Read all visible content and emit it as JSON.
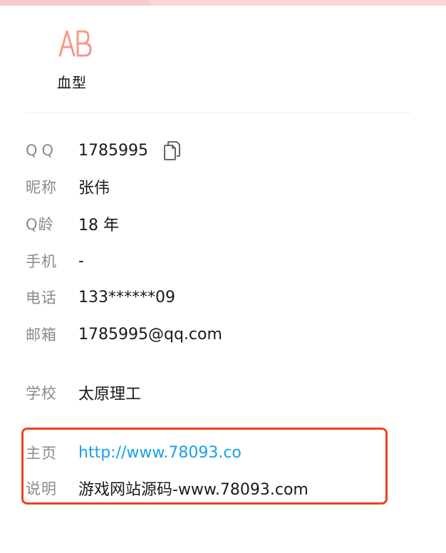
{
  "blood_type": {
    "icon": "ab-blood-type-icon",
    "label": "血型"
  },
  "profile": {
    "rows": [
      {
        "label": "QQ",
        "value": "1785995"
      },
      {
        "label": "昵称",
        "value": "张伟"
      },
      {
        "label": "Q龄",
        "value": "18 年"
      },
      {
        "label": "手机",
        "value": "-"
      },
      {
        "label": "电话",
        "value": "133******09"
      },
      {
        "label": "邮箱",
        "value": "1785995@qq.com"
      }
    ],
    "school": {
      "label": "学校",
      "value": "太原理工"
    },
    "homepage": {
      "label": "主页",
      "value": "http://www.78093.co"
    },
    "description": {
      "label": "说明",
      "value": "游戏网站源码-www.78093.com"
    }
  },
  "colors": {
    "link": "#1aa0e6",
    "highlight": "#f04020",
    "label": "#8a8a8a"
  }
}
